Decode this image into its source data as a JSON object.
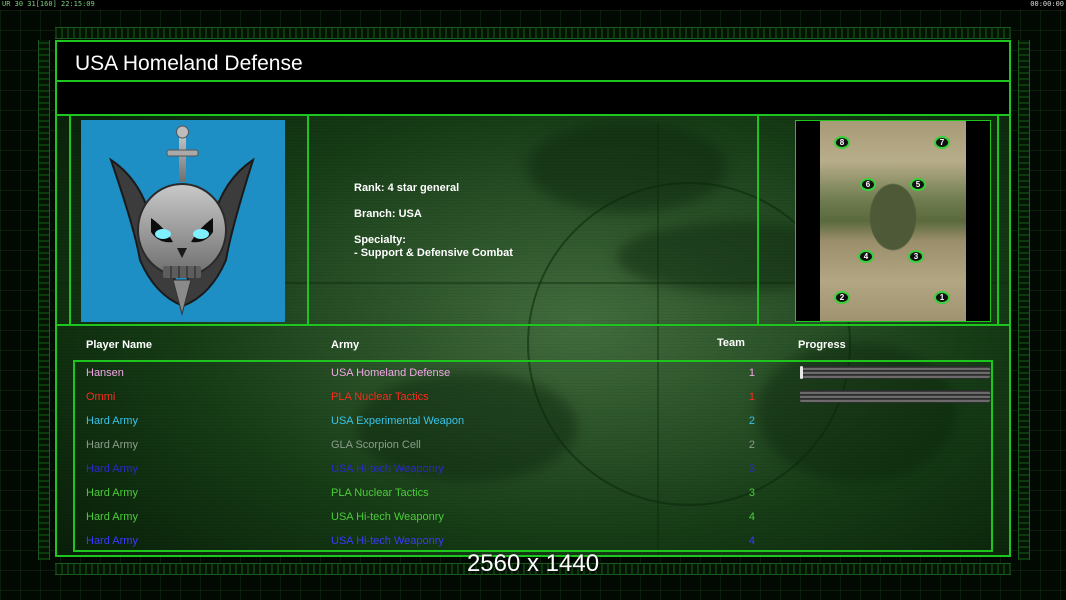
{
  "hud": {
    "left": "UR 30 31[160] 22:15:09",
    "right": "00:00:00"
  },
  "title": "USA Homeland Defense",
  "general": {
    "rank": "Rank: 4 star general",
    "branch": "Branch: USA",
    "specialty_label": "Specialty:",
    "specialty_value": "- Support & Defensive Combat",
    "emblem_icon": "skull-sword-emblem-icon",
    "portrait_color": "#1d8fc4"
  },
  "map": {
    "spawns": [
      "8",
      "7",
      "6",
      "5",
      "4",
      "3",
      "2",
      "1"
    ]
  },
  "headers": {
    "name": "Player Name",
    "army": "Army",
    "team": "Team",
    "progress": "Progress"
  },
  "players": [
    {
      "name": "Hansen",
      "army": "USA Homeland Defense",
      "team": "1",
      "color": "#f4a6e8",
      "progress": 0.01
    },
    {
      "name": "Ommi",
      "army": "PLA Nuclear Tactics",
      "team": "1",
      "color": "#ff2a1a",
      "progress": 0.0
    },
    {
      "name": "Hard Army",
      "army": "USA Experimental Weapon",
      "team": "2",
      "color": "#38c4e8",
      "progress": null
    },
    {
      "name": "Hard Army",
      "army": "GLA Scorpion Cell",
      "team": "2",
      "color": "#8c9c8c",
      "progress": null
    },
    {
      "name": "Hard Army",
      "army": "USA Hi-tech Weaponry",
      "team": "3",
      "color": "#2a2ac8",
      "progress": null
    },
    {
      "name": "Hard Army",
      "army": "PLA Nuclear Tactics",
      "team": "3",
      "color": "#4ccc3a",
      "progress": null
    },
    {
      "name": "Hard Army",
      "army": "USA Hi-tech Weaponry",
      "team": "4",
      "color": "#4ccc3a",
      "progress": null
    },
    {
      "name": "Hard Army",
      "army": "USA Hi-tech Weaponry",
      "team": "4",
      "color": "#3a3aff",
      "progress": null
    }
  ],
  "watermark": "2560 x 1440"
}
